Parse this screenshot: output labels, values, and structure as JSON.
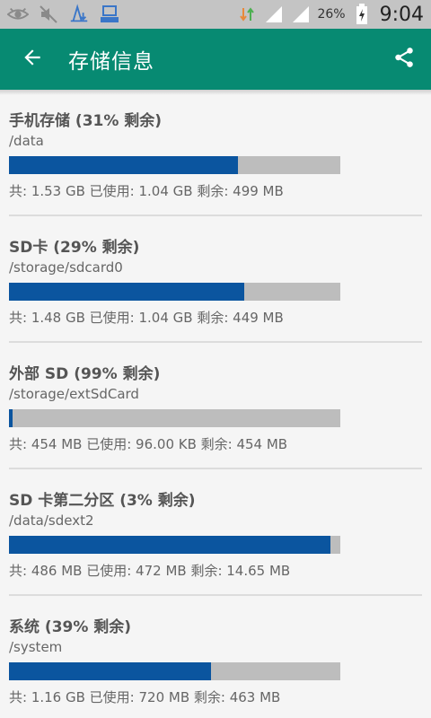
{
  "statusbar": {
    "battery_percent": "26%",
    "time": "9:04"
  },
  "appbar": {
    "title": "存储信息",
    "color": "#078a72"
  },
  "colors": {
    "used": "#0b559f",
    "free": "#bdbdbd"
  },
  "storages": [
    {
      "title": "手机存储 (31% 剩余)",
      "path": "/data",
      "used_fraction": 0.69,
      "detail": "共: 1.53 GB 已使用: 1.04 GB 剩余: 499 MB"
    },
    {
      "title": "SD卡 (29% 剩余)",
      "path": "/storage/sdcard0",
      "used_fraction": 0.71,
      "detail": "共: 1.48 GB 已使用: 1.04 GB 剩余: 449 MB"
    },
    {
      "title": "外部 SD (99% 剩余)",
      "path": "/storage/extSdCard",
      "used_fraction": 0.01,
      "detail": "共: 454 MB 已使用: 96.00 KB 剩余: 454 MB"
    },
    {
      "title": "SD 卡第二分区 (3% 剩余)",
      "path": "/data/sdext2",
      "used_fraction": 0.97,
      "detail": "共: 486 MB 已使用: 472 MB 剩余: 14.65 MB"
    },
    {
      "title": "系统 (39% 剩余)",
      "path": "/system",
      "used_fraction": 0.61,
      "detail": "共: 1.16 GB 已使用: 720 MB 剩余: 463 MB"
    }
  ]
}
